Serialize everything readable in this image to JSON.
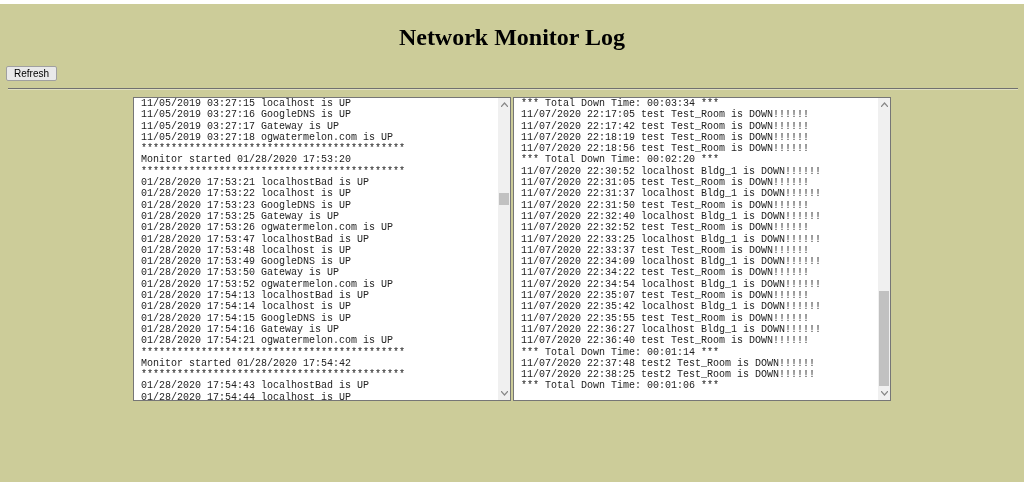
{
  "title": "Network Monitor Log",
  "refresh_button": "Refresh",
  "logs": [
    {
      "lines": [
        "11/05/2019 03:27:15 localhost is UP",
        "11/05/2019 03:27:16 GoogleDNS is UP",
        "11/05/2019 03:27:17 Gateway is UP",
        "11/05/2019 03:27:18 ogwatermelon.com is UP",
        "********************************************",
        "Monitor started 01/28/2020 17:53:20",
        "********************************************",
        "01/28/2020 17:53:21 localhostBad is UP",
        "01/28/2020 17:53:22 localhost is UP",
        "01/28/2020 17:53:23 GoogleDNS is UP",
        "01/28/2020 17:53:25 Gateway is UP",
        "01/28/2020 17:53:26 ogwatermelon.com is UP",
        "01/28/2020 17:53:47 localhostBad is UP",
        "01/28/2020 17:53:48 localhost is UP",
        "01/28/2020 17:53:49 GoogleDNS is UP",
        "01/28/2020 17:53:50 Gateway is UP",
        "01/28/2020 17:53:52 ogwatermelon.com is UP",
        "01/28/2020 17:54:13 localhostBad is UP",
        "01/28/2020 17:54:14 localhost is UP",
        "01/28/2020 17:54:15 GoogleDNS is UP",
        "01/28/2020 17:54:16 Gateway is UP",
        "01/28/2020 17:54:21 ogwatermelon.com is UP",
        "********************************************",
        "Monitor started 01/28/2020 17:54:42",
        "********************************************",
        "01/28/2020 17:54:43 localhostBad is UP",
        "01/28/2020 17:54:44 localhost is UP"
      ]
    },
    {
      "lines": [
        "*** Total Down Time: 00:03:34 ***",
        "11/07/2020 22:17:05 test Test_Room is DOWN!!!!!!",
        "11/07/2020 22:17:42 test Test_Room is DOWN!!!!!!",
        "11/07/2020 22:18:19 test Test_Room is DOWN!!!!!!",
        "11/07/2020 22:18:56 test Test_Room is DOWN!!!!!!",
        "*** Total Down Time: 00:02:20 ***",
        "11/07/2020 22:30:52 localhost Bldg_1 is DOWN!!!!!!",
        "11/07/2020 22:31:05 test Test_Room is DOWN!!!!!!",
        "11/07/2020 22:31:37 localhost Bldg_1 is DOWN!!!!!!",
        "11/07/2020 22:31:50 test Test_Room is DOWN!!!!!!",
        "11/07/2020 22:32:40 localhost Bldg_1 is DOWN!!!!!!",
        "11/07/2020 22:32:52 test Test_Room is DOWN!!!!!!",
        "11/07/2020 22:33:25 localhost Bldg_1 is DOWN!!!!!!",
        "11/07/2020 22:33:37 test Test_Room is DOWN!!!!!!",
        "11/07/2020 22:34:09 localhost Bldg_1 is DOWN!!!!!!",
        "11/07/2020 22:34:22 test Test_Room is DOWN!!!!!!",
        "11/07/2020 22:34:54 localhost Bldg_1 is DOWN!!!!!!",
        "11/07/2020 22:35:07 test Test_Room is DOWN!!!!!!",
        "11/07/2020 22:35:42 localhost Bldg_1 is DOWN!!!!!!",
        "11/07/2020 22:35:55 test Test_Room is DOWN!!!!!!",
        "11/07/2020 22:36:27 localhost Bldg_1 is DOWN!!!!!!",
        "11/07/2020 22:36:40 test Test_Room is DOWN!!!!!!",
        "*** Total Down Time: 00:01:14 ***",
        "11/07/2020 22:37:48 test2 Test_Room is DOWN!!!!!!",
        "11/07/2020 22:38:25 test2 Test_Room is DOWN!!!!!!",
        "*** Total Down Time: 00:01:06 ***"
      ]
    }
  ]
}
